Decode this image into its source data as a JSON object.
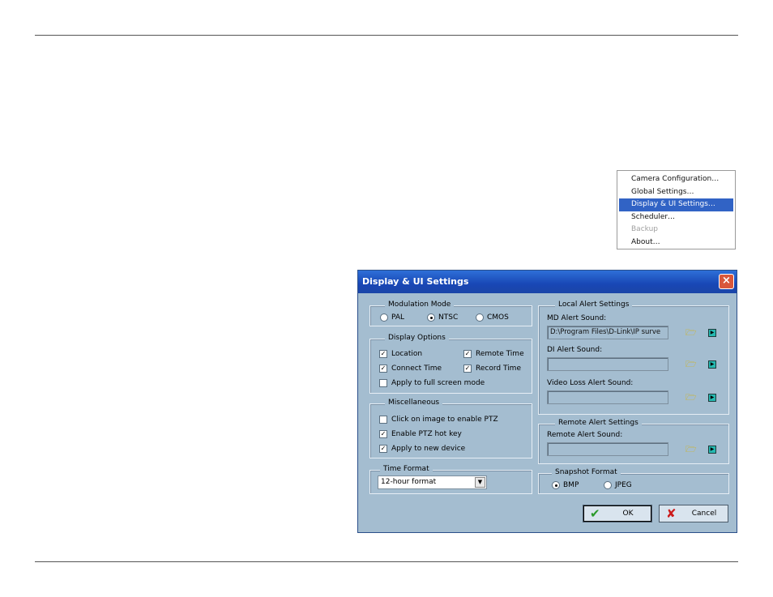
{
  "menu": {
    "items": [
      {
        "label": "Camera Configuration…",
        "state": "normal"
      },
      {
        "label": "Global Settings…",
        "state": "normal"
      },
      {
        "label": "Display & UI Settings…",
        "state": "selected"
      },
      {
        "label": "Scheduler…",
        "state": "normal"
      },
      {
        "label": "Backup",
        "state": "disabled"
      },
      {
        "label": "About…",
        "state": "normal"
      }
    ]
  },
  "dialog": {
    "title": "Display & UI Settings",
    "close_icon": "×",
    "modulation": {
      "legend": "Modulation Mode",
      "options": [
        "PAL",
        "NTSC",
        "CMOS"
      ],
      "selected": "NTSC"
    },
    "display_options": {
      "legend": "Display Options",
      "location": "Location",
      "remote_time": "Remote Time",
      "connect_time": "Connect Time",
      "record_time": "Record Time",
      "full_screen": "Apply to full screen mode"
    },
    "misc": {
      "legend": "Miscellaneous",
      "click_ptz": "Click on image to enable PTZ",
      "ptz_hotkey": "Enable PTZ hot key",
      "apply_new": "Apply to new device"
    },
    "time_format": {
      "legend": "Time Format",
      "value": "12-hour format"
    },
    "local_alert": {
      "legend": "Local Alert Settings",
      "md_label": "MD Alert Sound:",
      "md_value": "D:\\Program Files\\D-Link\\IP surve",
      "di_label": "DI Alert Sound:",
      "di_value": "",
      "vl_label": "Video Loss Alert Sound:",
      "vl_value": ""
    },
    "remote_alert": {
      "legend": "Remote Alert Settings",
      "label": "Remote Alert Sound:",
      "value": ""
    },
    "snapshot": {
      "legend": "Snapshot Format",
      "options": [
        "BMP",
        "JPEG"
      ],
      "selected": "BMP"
    },
    "ok_label": "OK",
    "cancel_label": "Cancel",
    "ok_icon": "✔",
    "cancel_icon": "✘",
    "icons": {
      "folder": "folder-open-icon",
      "play": "play-icon"
    },
    "colors": {
      "titlebar": "#1f53c6",
      "body": "#a4bdd0",
      "menu_highlight": "#3163c5"
    }
  }
}
